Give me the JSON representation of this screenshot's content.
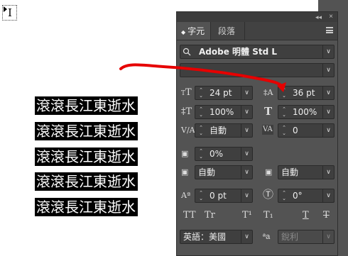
{
  "text_lines": [
    "滾滾長江東逝水",
    "滾滾長江東逝水",
    "滾滾長江東逝水",
    "滾滾長江東逝水",
    "滾滾長江東逝水"
  ],
  "type_tool_glyph": "I",
  "panel": {
    "collapse_glyph": "◂◂",
    "close_glyph": "×",
    "tabs": [
      {
        "label": "字元",
        "active": true
      },
      {
        "label": "段落",
        "active": false
      }
    ],
    "font_family": "Adobe 明體 Std L",
    "font_style": "",
    "font_size": "24 pt",
    "leading": "36 pt",
    "vertical_scale": "100%",
    "horizontal_scale": "100%",
    "kerning": "自動",
    "tracking": "0",
    "tsume": "0%",
    "aki_left": "自動",
    "aki_right": "自動",
    "baseline_shift": "0 pt",
    "rotation": "0°",
    "style_buttons": [
      "TT",
      "Tr",
      "T¹",
      "T₁",
      "T",
      "T"
    ],
    "language": "英語：美國",
    "antialias": "銳利"
  },
  "icons": {
    "font_size": "font-size-icon",
    "leading": "leading-icon",
    "vertical_scale": "vertical-scale-icon",
    "horizontal_scale": "horizontal-scale-icon",
    "kerning": "kerning-icon",
    "tracking": "tracking-icon",
    "tsume": "tsume-icon",
    "aki_left": "aki-left-icon",
    "aki_right": "aki-right-icon",
    "baseline_shift": "baseline-shift-icon",
    "rotation": "character-rotation-icon",
    "antialias": "antialias-icon"
  },
  "colors": {
    "panel_bg": "#535353",
    "field_bg": "#3f3f3f",
    "highlight": "#000000",
    "annotation": "#e60000"
  }
}
